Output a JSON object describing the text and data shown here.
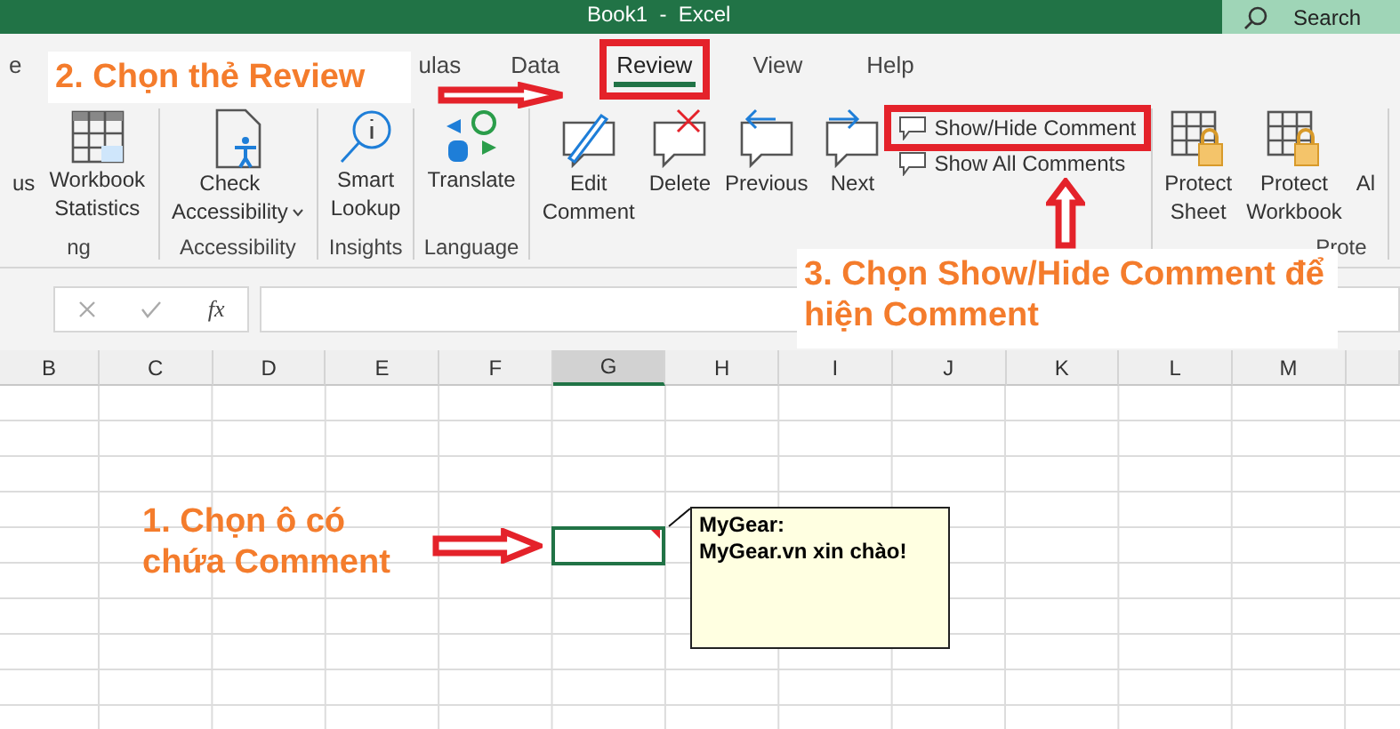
{
  "title_bar": {
    "title": "Book1  -  Excel",
    "search": "Search"
  },
  "tabs": [
    {
      "label": "e",
      "selected": false,
      "highlighted": false
    },
    {
      "label": "ulas",
      "selected": false,
      "highlighted": false
    },
    {
      "label": "Data",
      "selected": false,
      "highlighted": false
    },
    {
      "label": "Review",
      "selected": true,
      "highlighted": true
    },
    {
      "label": "View",
      "selected": false,
      "highlighted": false
    },
    {
      "label": "Help",
      "selected": false,
      "highlighted": false
    }
  ],
  "ribbon": {
    "groups": [
      {
        "label": "ng",
        "buttons": [
          {
            "label": "us"
          },
          {
            "label": "Workbook Statistics"
          }
        ]
      },
      {
        "label": "Accessibility",
        "buttons": [
          {
            "label": "Check Accessibility",
            "dropdown": true
          }
        ]
      },
      {
        "label": "Insights",
        "buttons": [
          {
            "label": "Smart Lookup"
          }
        ]
      },
      {
        "label": "Language",
        "buttons": [
          {
            "label": "Translate"
          }
        ]
      },
      {
        "buttons": [
          {
            "label": "Edit Comment"
          },
          {
            "label": "Delete"
          },
          {
            "label": "Previous"
          },
          {
            "label": "Next"
          }
        ],
        "small_buttons": [
          {
            "label": "Show/Hide Comment",
            "highlighted": true
          },
          {
            "label": "Show All Comments",
            "highlighted": false
          }
        ]
      },
      {
        "label": "Prote",
        "buttons": [
          {
            "label": "Protect Sheet"
          },
          {
            "label": "Protect Workbook"
          },
          {
            "label": "Al"
          }
        ]
      }
    ]
  },
  "formula_bar": {
    "function_label": "fx"
  },
  "sheet": {
    "columns": [
      {
        "label": "B",
        "selected": false
      },
      {
        "label": "C",
        "selected": false
      },
      {
        "label": "D",
        "selected": false
      },
      {
        "label": "E",
        "selected": false
      },
      {
        "label": "F",
        "selected": false
      },
      {
        "label": "G",
        "selected": true
      },
      {
        "label": "H",
        "selected": false
      },
      {
        "label": "I",
        "selected": false
      },
      {
        "label": "J",
        "selected": false
      },
      {
        "label": "K",
        "selected": false
      },
      {
        "label": "L",
        "selected": false
      },
      {
        "label": "M",
        "selected": false
      }
    ]
  },
  "comment": {
    "author": "MyGear:",
    "text": "MyGear.vn xin chào!"
  },
  "annotations": [
    {
      "text": "2. Chọn thẻ Review"
    },
    {
      "text": "3. Chọn Show/Hide Comment để hiện Comment"
    },
    {
      "text": "1. Chọn ô có chứa Comment"
    }
  ]
}
